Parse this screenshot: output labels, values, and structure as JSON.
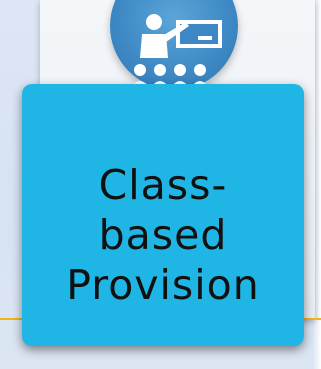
{
  "card": {
    "label_lines": [
      "Class-",
      "based",
      "Provision"
    ],
    "icon": "classroom-teacher-icon"
  },
  "colors": {
    "card": "#1fb6e6",
    "icon_circle": "#3d88c4",
    "accent_line": "#f3b417",
    "background": "#dde6f4"
  }
}
